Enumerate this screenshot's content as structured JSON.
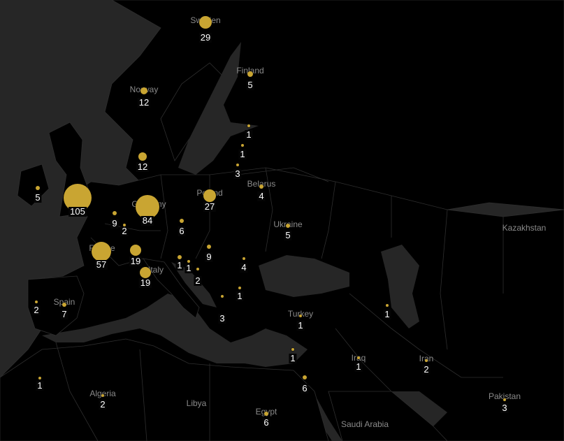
{
  "colors": {
    "background": "#1c1c1c",
    "land": "#000000",
    "border": "#2e2e2e",
    "sea": "#262626",
    "marker": "#c9a532",
    "label_text": "#ffffff",
    "country_text": "#8a8a8a"
  },
  "country_labels": [
    {
      "name": "Sweden"
    },
    {
      "name": "Finland"
    },
    {
      "name": "Norway"
    },
    {
      "name": "Belarus"
    },
    {
      "name": "Poland"
    },
    {
      "name": "Germany"
    },
    {
      "name": "France"
    },
    {
      "name": "Spain"
    },
    {
      "name": "Italy"
    },
    {
      "name": "Ukraine"
    },
    {
      "name": "Kazakhstan"
    },
    {
      "name": "Turkey"
    },
    {
      "name": "Iraq"
    },
    {
      "name": "Iran"
    },
    {
      "name": "Algeria"
    },
    {
      "name": "Libya"
    },
    {
      "name": "Egypt"
    },
    {
      "name": "Saudi Arabia"
    },
    {
      "name": "Pakistan"
    }
  ],
  "markers": [
    {
      "count": 29
    },
    {
      "count": 5
    },
    {
      "count": 12
    },
    {
      "count": 1
    },
    {
      "count": 1
    },
    {
      "count": 3
    },
    {
      "count": 4
    },
    {
      "count": 12
    },
    {
      "count": 5
    },
    {
      "count": 105
    },
    {
      "count": 84
    },
    {
      "count": 27
    },
    {
      "count": 9
    },
    {
      "count": 2
    },
    {
      "count": 6
    },
    {
      "count": 5
    },
    {
      "count": 57
    },
    {
      "count": 19
    },
    {
      "count": 1
    },
    {
      "count": 1
    },
    {
      "count": 9
    },
    {
      "count": 4
    },
    {
      "count": 2
    },
    {
      "count": 19
    },
    {
      "count": 1
    },
    {
      "count": 2
    },
    {
      "count": 7
    },
    {
      "count": 1
    },
    {
      "count": 3
    },
    {
      "count": 1
    },
    {
      "count": 1
    },
    {
      "count": 1
    },
    {
      "count": 2
    },
    {
      "count": 6
    },
    {
      "count": 1
    },
    {
      "count": 2
    },
    {
      "count": 6
    },
    {
      "count": 3
    }
  ]
}
